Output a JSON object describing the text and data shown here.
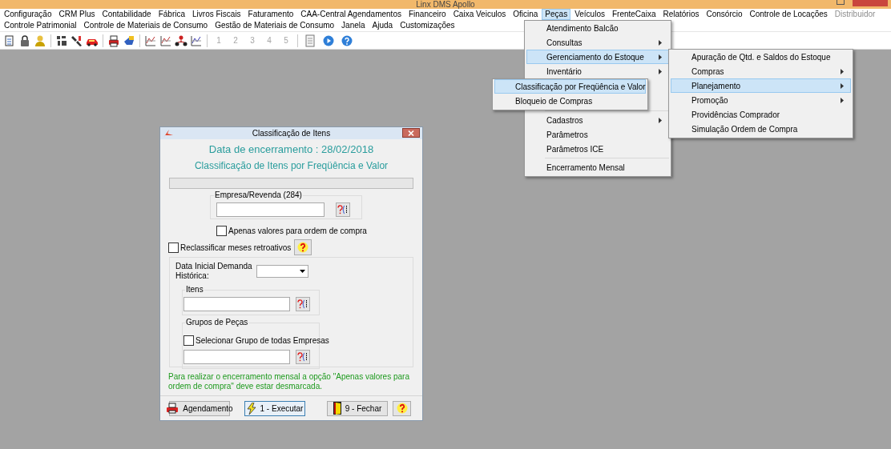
{
  "window": {
    "title": "Linx DMS Apollo"
  },
  "menubar": [
    [
      {
        "label": "Configuração",
        "selected": false,
        "disabled": false
      },
      {
        "label": "CRM Plus",
        "selected": false,
        "disabled": false
      },
      {
        "label": "Contabilidade",
        "selected": false,
        "disabled": false
      },
      {
        "label": "Fábrica",
        "selected": false,
        "disabled": false
      },
      {
        "label": "Livros Fiscais",
        "selected": false,
        "disabled": false
      },
      {
        "label": "Faturamento",
        "selected": false,
        "disabled": false
      },
      {
        "label": "CAA-Central Agendamentos",
        "selected": false,
        "disabled": false
      },
      {
        "label": "Financeiro",
        "selected": false,
        "disabled": false
      },
      {
        "label": "Caixa Veiculos",
        "selected": false,
        "disabled": false
      },
      {
        "label": "Oficina",
        "selected": false,
        "disabled": false
      },
      {
        "label": "Peças",
        "selected": true,
        "disabled": false
      },
      {
        "label": "Veículos",
        "selected": false,
        "disabled": false
      },
      {
        "label": "FrenteCaixa",
        "selected": false,
        "disabled": false
      },
      {
        "label": "Relatórios",
        "selected": false,
        "disabled": false
      },
      {
        "label": "Consórcio",
        "selected": false,
        "disabled": false
      },
      {
        "label": "Controle de Locações",
        "selected": false,
        "disabled": false
      },
      {
        "label": "Distribuidor",
        "selected": false,
        "disabled": true
      }
    ],
    [
      {
        "label": "Controle Patrimonial",
        "selected": false,
        "disabled": false
      },
      {
        "label": "Controle de Materiais de Consumo",
        "selected": false,
        "disabled": false
      },
      {
        "label": "Gestão de Materiais de Consumo",
        "selected": false,
        "disabled": false
      },
      {
        "label": "Janela",
        "selected": false,
        "disabled": false
      },
      {
        "label": "Ajuda",
        "selected": false,
        "disabled": false
      },
      {
        "label": "Customizações",
        "selected": false,
        "disabled": false
      }
    ]
  ],
  "toolbar": {
    "numbers": [
      {
        "label": "1",
        "disabled": true
      },
      {
        "label": "2",
        "disabled": true
      },
      {
        "label": "3",
        "disabled": true
      },
      {
        "label": "4",
        "disabled": true
      },
      {
        "label": "5",
        "disabled": true
      }
    ]
  },
  "pecas_menu": {
    "sections": [
      [
        {
          "label": "Atendimento Balcão",
          "submenu": false,
          "selected": false
        },
        {
          "label": "Consultas",
          "submenu": true,
          "selected": false
        },
        {
          "label": "Gerenciamento do Estoque",
          "submenu": true,
          "selected": true
        },
        {
          "label": "Inventário",
          "submenu": true,
          "selected": false
        }
      ],
      [
        {
          "label": "Cadastros",
          "submenu": true,
          "selected": false
        },
        {
          "label": "Parâmetros",
          "submenu": false,
          "selected": false
        },
        {
          "label": "Parâmetros ICE",
          "submenu": false,
          "selected": false
        }
      ],
      [
        {
          "label": "Encerramento Mensal",
          "submenu": false,
          "selected": false
        }
      ]
    ]
  },
  "estoque_menu": {
    "items": [
      {
        "label": "Apuração de Qtd. e Saldos do Estoque",
        "submenu": false,
        "selected": false
      },
      {
        "label": "Compras",
        "submenu": true,
        "selected": false
      },
      {
        "label": "Planejamento",
        "submenu": true,
        "selected": true
      },
      {
        "label": "Promoção",
        "submenu": true,
        "selected": false
      },
      {
        "label": "Providências Comprador",
        "submenu": false,
        "selected": false
      },
      {
        "label": "Simulação Ordem de Compra",
        "submenu": false,
        "selected": false
      }
    ]
  },
  "planejamento_menu": {
    "items": [
      {
        "label": "Classificação por Freqüência e Valor",
        "submenu": false,
        "selected": true
      },
      {
        "label": "Bloqueio de Compras",
        "submenu": false,
        "selected": false
      }
    ]
  },
  "dialog": {
    "title": "Classificação de Itens",
    "heading": "Data de encerramento : 28/02/2018",
    "subheading": "Classificação de Itens por Freqüência e Valor",
    "progress": {
      "level": 0
    },
    "empresa_group": {
      "label": "Empresa/Revenda (284)"
    },
    "apenas_valores": {
      "label": "Apenas valores para ordem de compra",
      "checked": false
    },
    "reclassificar": {
      "label": "Reclassificar meses retroativos",
      "checked": false
    },
    "data_inicial": {
      "label": "Data Inicial Demanda Histórica:"
    },
    "itens_group": {
      "label": "Itens"
    },
    "grupos_group": {
      "label": "Grupos de Peças",
      "checkbox": {
        "label": "Selecionar Grupo de todas Empresas",
        "checked": false
      }
    },
    "note": "Para realizar o encerramento mensal a opção \"Apenas valores para ordem de compra\" deve estar desmarcada.",
    "buttons": [
      {
        "kind": "schedule",
        "label": "Agendamento",
        "focused": false
      },
      {
        "kind": "execute",
        "label": "1 - Executar",
        "focused": true
      },
      {
        "kind": "close",
        "label": "9 - Fechar",
        "focused": false
      },
      {
        "kind": "help",
        "focused": false
      }
    ]
  }
}
